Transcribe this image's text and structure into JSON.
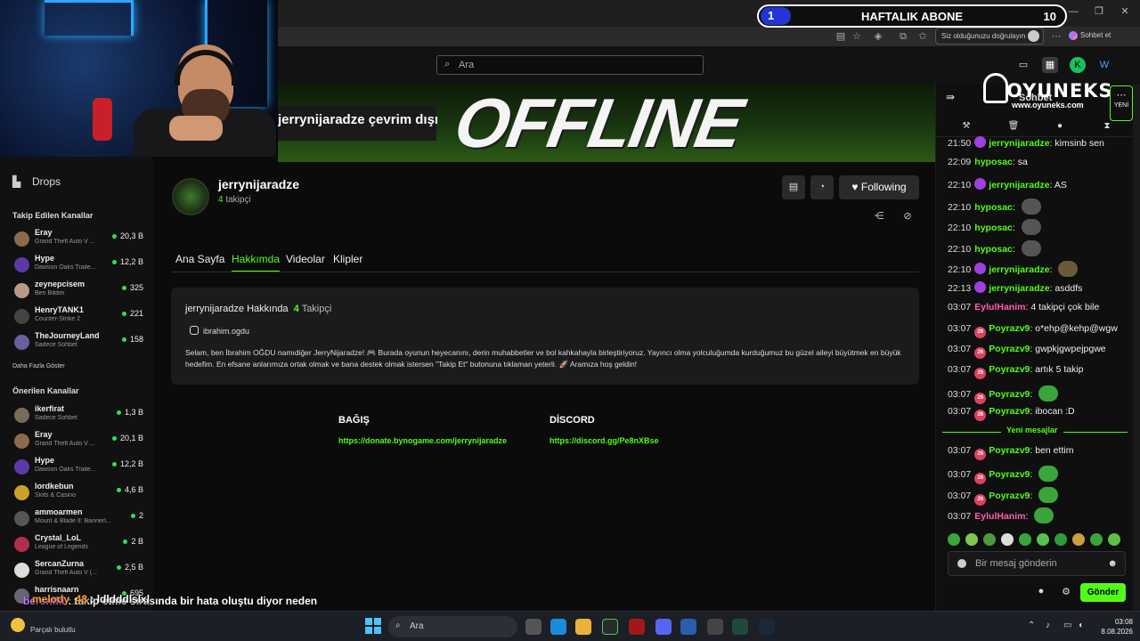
{
  "goal": {
    "count": "1",
    "title": "HAFTALIK ABONE",
    "target": "10"
  },
  "browser": {
    "verify_pill": "Siz olduğunuzu doğrulayın",
    "copilot": "Sohbet et",
    "search_placeholder": "Ara"
  },
  "sidebar": {
    "drops": "Drops",
    "followed_title": "Takip Edilen Kanallar",
    "followed": [
      {
        "name": "Eray",
        "game": "Grand Theft Auto V ...",
        "viewers": "20,3 B",
        "color": "#8b6b4a"
      },
      {
        "name": "Hype",
        "game": "Dawson Oaks Traile...",
        "viewers": "12,2 B",
        "color": "#5b3aa8"
      },
      {
        "name": "zeynepcisem",
        "game": "Ben Bildim",
        "viewers": "325",
        "color": "#b89a8a"
      },
      {
        "name": "HenryTANK1",
        "game": "Counter-Strike 2",
        "viewers": "221",
        "color": "#444"
      },
      {
        "name": "TheJourneyLand",
        "game": "Sadece Sohbet",
        "viewers": "158",
        "color": "#6a5fa0"
      }
    ],
    "show_more": "Daha Fazla Göster",
    "recommended_title": "Önerilen Kanallar",
    "recommended": [
      {
        "name": "ikerfirat",
        "game": "Sadece Sohbet",
        "viewers": "1,3 B",
        "color": "#7a6a5a"
      },
      {
        "name": "Eray",
        "game": "Grand Theft Auto V ...",
        "viewers": "20,1 B",
        "color": "#8b6b4a"
      },
      {
        "name": "Hype",
        "game": "Dawson Oaks Traile...",
        "viewers": "12,2 B",
        "color": "#5b3aa8"
      },
      {
        "name": "lordkebun",
        "game": "Slots & Casino",
        "viewers": "4,6 B",
        "color": "#c9a227"
      },
      {
        "name": "ammoarmen",
        "game": "Mount & Blade II: Bannerl...",
        "viewers": "2",
        "color": "#555"
      },
      {
        "name": "Crystal_LoL",
        "game": "League of Legends",
        "viewers": "2 B",
        "color": "#b0304a"
      },
      {
        "name": "SercanZurna",
        "game": "Grand Theft Auto V (...",
        "viewers": "2,5 B",
        "color": "#ddd"
      },
      {
        "name": "harrisnaarn",
        "game": "",
        "viewers": "695",
        "color": "#667"
      }
    ]
  },
  "banner": {
    "offline_word": "OFFLINE",
    "status": "jerrynijaradze çevrim dışı"
  },
  "channel": {
    "name": "jerrynijaradze",
    "followers": "4",
    "followers_label": "takipçi",
    "following_label": "Following"
  },
  "tabs": [
    "Ana Sayfa",
    "Hakkımda",
    "Videolar",
    "Klipler"
  ],
  "about": {
    "title": "jerrynijaradze Hakkında",
    "followers": "4",
    "followers_label": "Takipçi",
    "instagram": "ibrahim.ogdu",
    "bio": "Selam, ben İbrahim OĞDU namıdiğer JerryNijaradze! 🎮 Burada oyunun heyecanını, derin muhabbetler ve bol kahkahayla birleştiriyoruz. Yayıncı olma yolculuğumda kurduğumuz bu güzel aileyi büyütmek en büyük hedefim. En efsane anlarımıza ortak olmak ve bana destek olmak istersen \"Takip Et\" butonuna tıklaman yeterli. 🚀 Aramıza hoş geldin!"
  },
  "links": [
    {
      "title": "BAĞIŞ",
      "url": "https://donate.bynogame.com/jerrynijaradze"
    },
    {
      "title": "DİSCORD",
      "url": "https://discord.gg/Pe8nXBse"
    }
  ],
  "chat": {
    "logo": "OYUNEKS",
    "logo_sub": "www.oyuneks.com",
    "header_hidden": "Sohbet",
    "yeni": "YENİ",
    "messages": [
      {
        "time": "21:50",
        "user": "jerrynijaradze",
        "text": "kimsinb sen",
        "color": "#53fc18",
        "badge": "#a040e0"
      },
      {
        "time": "22:09",
        "user": "hyposac",
        "text": "sa",
        "color": "#53fc18",
        "badge": ""
      },
      {
        "time": "22:10",
        "user": "jerrynijaradze",
        "text": "AS",
        "color": "#53fc18",
        "badge": "#a040e0"
      },
      {
        "time": "22:10",
        "user": "hyposac",
        "text": "",
        "color": "#53fc18",
        "badge": "",
        "emote": "#555"
      },
      {
        "time": "22:10",
        "user": "hyposac",
        "text": "",
        "color": "#53fc18",
        "badge": "",
        "emote": "#555"
      },
      {
        "time": "22:10",
        "user": "hyposac",
        "text": "",
        "color": "#53fc18",
        "badge": "",
        "emote": "#555"
      },
      {
        "time": "22:10",
        "user": "jerrynijaradze",
        "text": "",
        "color": "#53fc18",
        "badge": "#a040e0",
        "emote": "#6b5a3a"
      },
      {
        "time": "22:13",
        "user": "jerrynijaradze",
        "text": "asddfs",
        "color": "#53fc18",
        "badge": "#a040e0"
      },
      {
        "time": "03:07",
        "user": "EylulHanim",
        "text": "4 takipçi çok bile",
        "color": "#ff5ea8",
        "badge": ""
      },
      {
        "time": "03:07",
        "user": "Poyrazv9",
        "text": "o*ehp@kehp@wgw",
        "color": "#53fc18",
        "badge": "#e04060",
        "badge_text": "26"
      },
      {
        "time": "03:07",
        "user": "Poyrazv9",
        "text": "gwpkjgwpejpgwe",
        "color": "#53fc18",
        "badge": "#e04060",
        "badge_text": "26"
      },
      {
        "time": "03:07",
        "user": "Poyrazv9",
        "text": "artık 5 takip",
        "color": "#53fc18",
        "badge": "#e04060",
        "badge_text": "26"
      },
      {
        "time": "03:07",
        "user": "Poyrazv9",
        "text": "",
        "color": "#53fc18",
        "badge": "#e04060",
        "badge_text": "26",
        "emote": "#3aa63a"
      },
      {
        "time": "03:07",
        "user": "Poyrazv9",
        "text": "ibocan :D",
        "color": "#53fc18",
        "badge": "#e04060",
        "badge_text": "26"
      }
    ],
    "new_messages_label": "Yeni mesajlar",
    "new_messages": [
      {
        "time": "03:07",
        "user": "Poyrazv9",
        "text": "ben ettim",
        "color": "#53fc18",
        "badge": "#e04060",
        "badge_text": "26"
      },
      {
        "time": "03:07",
        "user": "Poyrazv9",
        "text": "",
        "color": "#53fc18",
        "badge": "#e04060",
        "badge_text": "26",
        "emote": "#3aa63a"
      },
      {
        "time": "03:07",
        "user": "Poyrazv9",
        "text": "",
        "color": "#53fc18",
        "badge": "#e04060",
        "badge_text": "26",
        "emote": "#3aa63a"
      },
      {
        "time": "03:07",
        "user": "EylulHanim",
        "text": "",
        "color": "#ff5ea8",
        "badge": "",
        "emote": "#3aa63a"
      }
    ],
    "input_placeholder": "Bir mesaj gönderin",
    "send_label": "Gönder"
  },
  "overlay": {
    "user1": "berentkl",
    "msg1": "takip etme sırasında bir hata oluştu diyor neden",
    "user2": "melody_48",
    "msg2": "ldldddlslxl"
  },
  "taskbar": {
    "weather": "Parçalı bulutlu",
    "search": "Ara",
    "time": "03:08",
    "date": "8.08.2026"
  }
}
